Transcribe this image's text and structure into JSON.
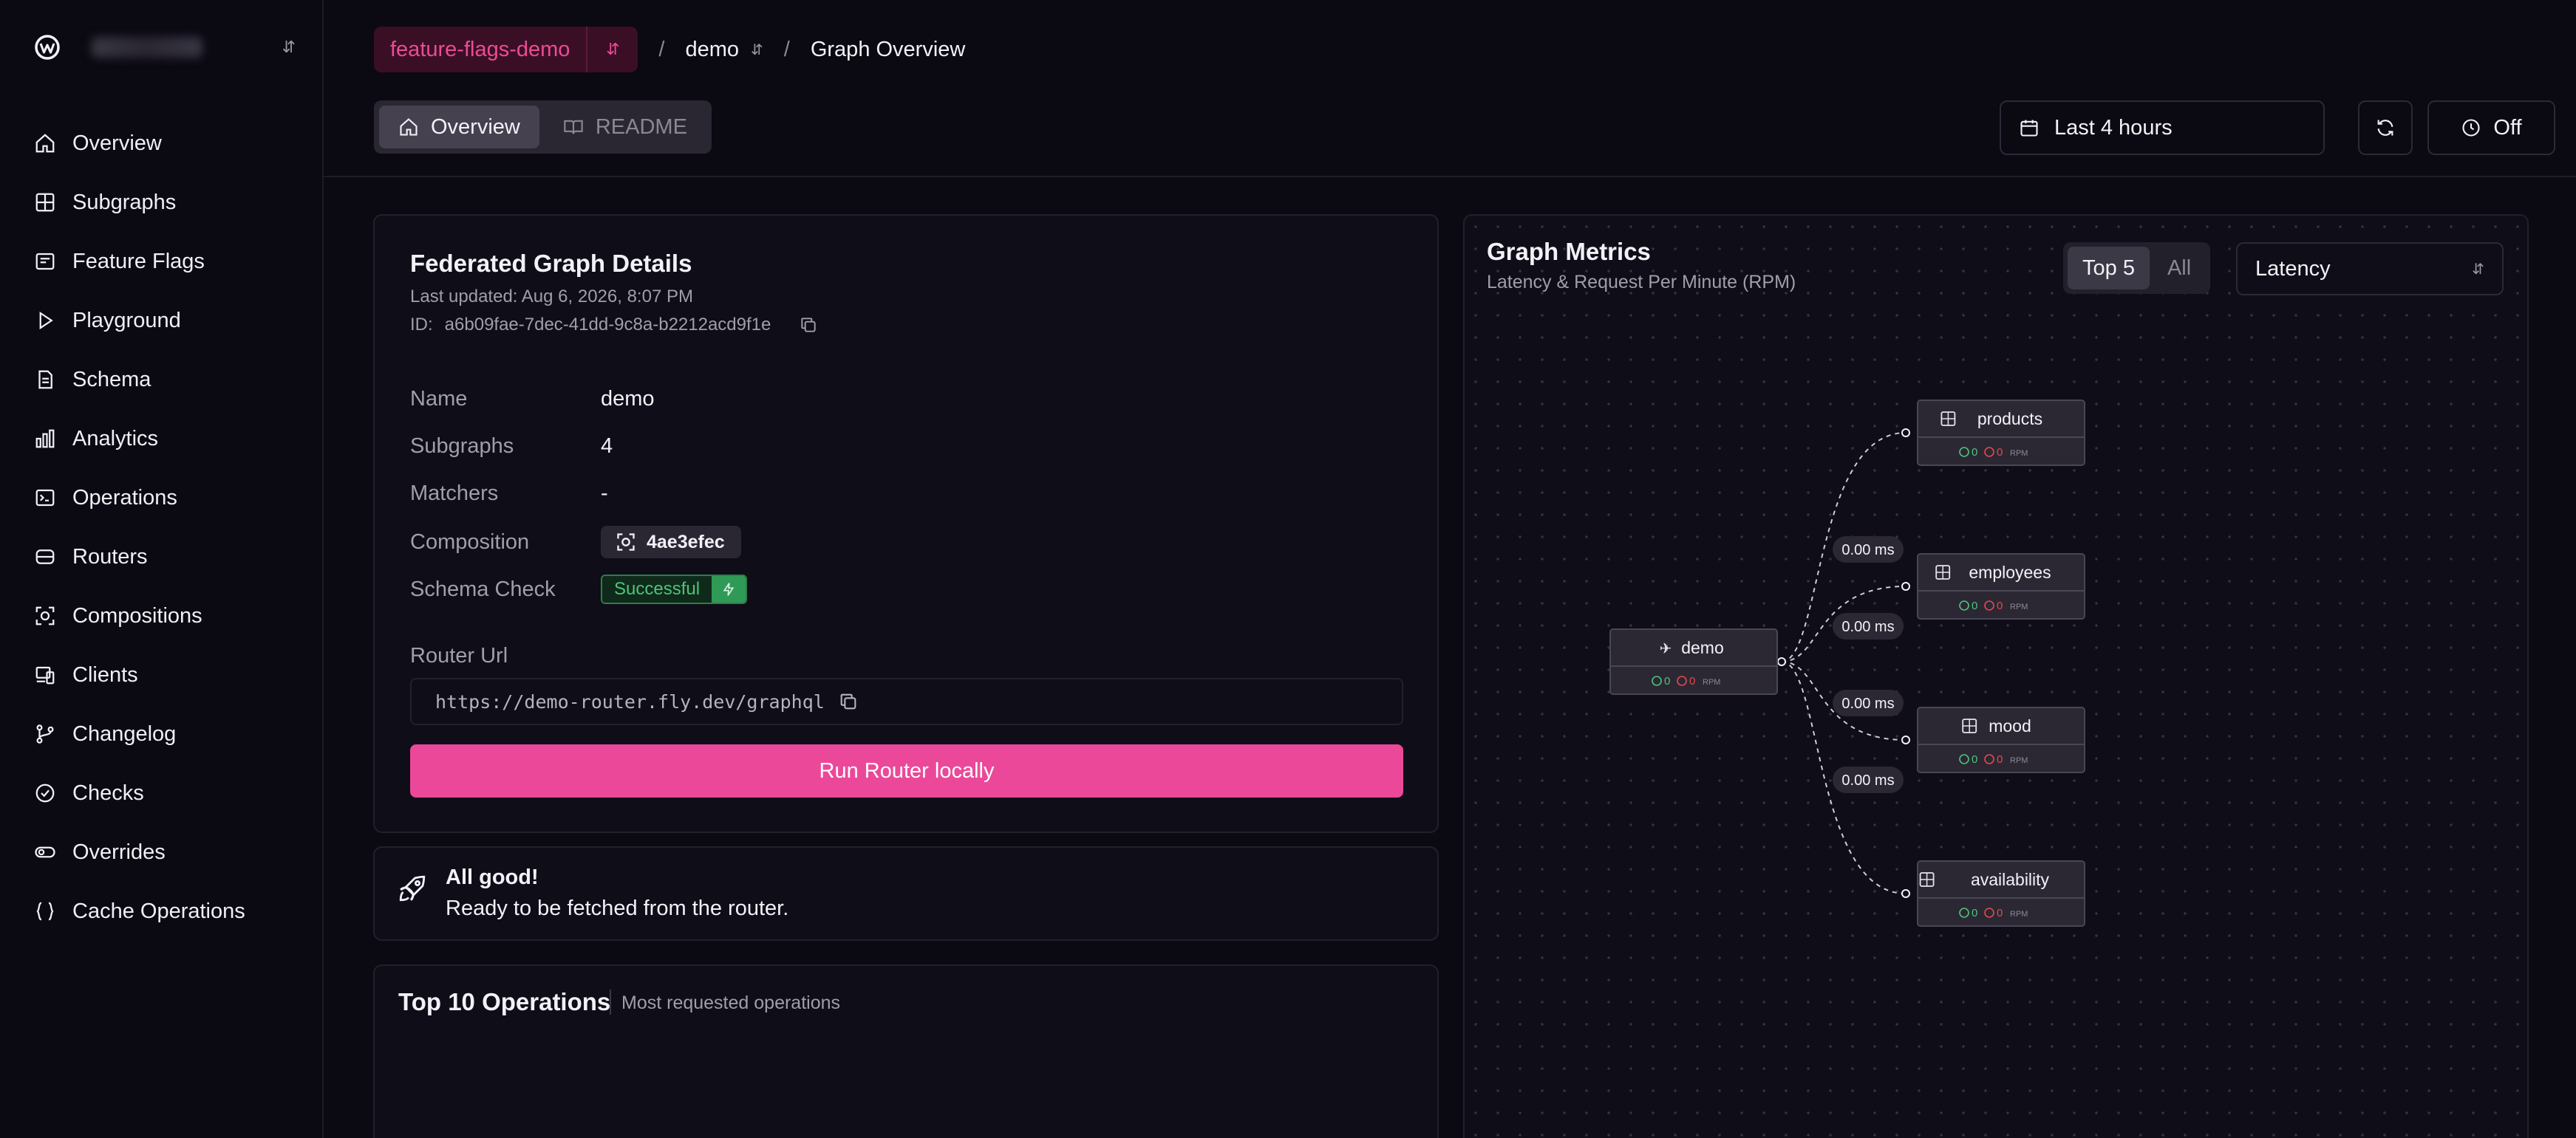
{
  "sidebar": {
    "items": [
      {
        "label": "Overview",
        "icon": "home-icon"
      },
      {
        "label": "Subgraphs",
        "icon": "grid-icon"
      },
      {
        "label": "Feature Flags",
        "icon": "flag-icon"
      },
      {
        "label": "Playground",
        "icon": "play-icon"
      },
      {
        "label": "Schema",
        "icon": "document-icon"
      },
      {
        "label": "Analytics",
        "icon": "bar-chart-icon"
      },
      {
        "label": "Operations",
        "icon": "terminal-icon"
      },
      {
        "label": "Routers",
        "icon": "server-icon"
      },
      {
        "label": "Compositions",
        "icon": "composition-icon"
      },
      {
        "label": "Clients",
        "icon": "devices-icon"
      },
      {
        "label": "Changelog",
        "icon": "git-branch-icon"
      },
      {
        "label": "Checks",
        "icon": "check-circle-icon"
      },
      {
        "label": "Overrides",
        "icon": "toggle-icon"
      },
      {
        "label": "Cache Operations",
        "icon": "braces-icon"
      }
    ]
  },
  "header": {
    "namespace": "feature-flags-demo",
    "graph": "demo",
    "page": "Graph Overview",
    "tabs": [
      {
        "label": "Overview",
        "active": true
      },
      {
        "label": "README",
        "active": false
      }
    ],
    "time_range": "Last 4 hours",
    "auto_refresh": "Off"
  },
  "details": {
    "title": "Federated Graph Details",
    "last_updated": "Last updated: Aug 6, 2026, 8:07 PM",
    "id_label": "ID:",
    "id_value": "a6b09fae-7dec-41dd-9c8a-b2212acd9f1e",
    "rows": {
      "name": {
        "label": "Name",
        "value": "demo"
      },
      "subgraphs": {
        "label": "Subgraphs",
        "value": "4"
      },
      "matchers": {
        "label": "Matchers",
        "value": "-"
      },
      "composition": {
        "label": "Composition",
        "value": "4ae3efec"
      },
      "schema_check": {
        "label": "Schema Check",
        "value": "Successful"
      }
    },
    "router_url_label": "Router Url",
    "router_url": "https://demo-router.fly.dev/graphql",
    "run_button": "Run Router locally"
  },
  "status": {
    "title": "All good!",
    "message": "Ready to be fetched from the router."
  },
  "top_ops": {
    "title": "Top 10 Operations",
    "subtitle": "Most requested operations"
  },
  "metrics": {
    "title": "Graph Metrics",
    "subtitle": "Latency & Request Per Minute (RPM)",
    "toggle": [
      {
        "label": "Top 5",
        "active": true
      },
      {
        "label": "All",
        "active": false
      }
    ],
    "metric": "Latency",
    "root": {
      "name": "demo",
      "ok": "0",
      "err": "0",
      "unit": "RPM"
    },
    "subgraphs": [
      {
        "name": "products",
        "ok": "0",
        "err": "0",
        "unit": "RPM",
        "latency": "0.00 ms"
      },
      {
        "name": "employees",
        "ok": "0",
        "err": "0",
        "unit": "RPM",
        "latency": "0.00 ms"
      },
      {
        "name": "mood",
        "ok": "0",
        "err": "0",
        "unit": "RPM",
        "latency": "0.00 ms"
      },
      {
        "name": "availability",
        "ok": "0",
        "err": "0",
        "unit": "RPM",
        "latency": "0.00 ms"
      }
    ]
  },
  "colors": {
    "accent": "#ec4899",
    "success": "#4ec47a",
    "error": "#e5484d",
    "background": "#0b0912"
  }
}
